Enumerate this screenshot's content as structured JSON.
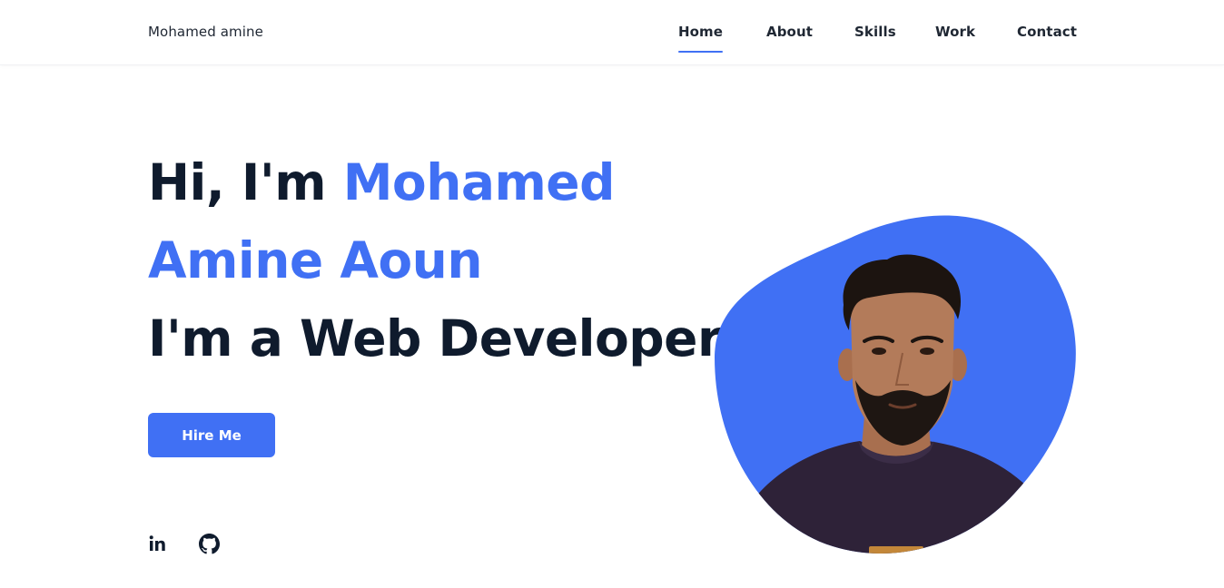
{
  "header": {
    "brand": "Mohamed amine",
    "nav": [
      {
        "label": "Home",
        "active": true
      },
      {
        "label": "About",
        "active": false
      },
      {
        "label": "Skills",
        "active": false
      },
      {
        "label": "Work",
        "active": false
      },
      {
        "label": "Contact",
        "active": false
      }
    ]
  },
  "hero": {
    "greeting": "Hi, I'm ",
    "name_line1": "Mohamed",
    "name_line2": "Amine Aoun",
    "role": "I'm a Web Developer",
    "cta_label": "Hire Me"
  },
  "social": [
    {
      "icon": "linkedin-icon",
      "text": "in"
    },
    {
      "icon": "github-icon"
    }
  ],
  "colors": {
    "accent": "#4070f4",
    "text": "#0f1b2d",
    "shirt": "#2e2238",
    "skin": "#b37b5a",
    "hair": "#1c1410"
  }
}
